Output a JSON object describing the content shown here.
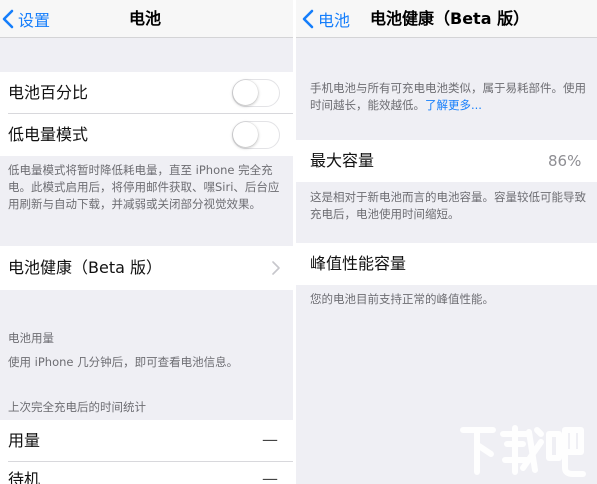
{
  "left": {
    "navbar": {
      "back_label": "设置",
      "title": "电池"
    },
    "battery_percentage": {
      "label": "电池百分比",
      "enabled": false
    },
    "low_power_mode": {
      "label": "低电量模式",
      "enabled": false
    },
    "low_power_footnote": "低电量模式将暂时降低耗电量，直至 iPhone 完全充电。此模式启用后，将停用邮件获取、嘿Siri、后台应用刷新与自动下载，并减弱或关闭部分视觉效果。",
    "battery_health_row": {
      "label": "电池健康（Beta 版）"
    },
    "battery_usage": {
      "header": "电池用量",
      "info": "使用 iPhone 几分钟后，即可查看电池信息。"
    },
    "stats": {
      "header": "上次完全充电后的时间统计",
      "rows": [
        {
          "label": "用量",
          "value": "—"
        },
        {
          "label": "待机",
          "value": "—"
        }
      ]
    }
  },
  "right": {
    "navbar": {
      "back_label": "电池",
      "title": "电池健康（Beta 版）"
    },
    "intro": {
      "text": "手机电池与所有可充电电池类似，属于易耗部件。使用时间越长，能效越低。",
      "link": "了解更多..."
    },
    "max_capacity": {
      "label": "最大容量",
      "value": "86%"
    },
    "max_capacity_footnote": "这是相对于新电池而言的电池容量。容量较低可能导致充电后，电池使用时间缩短。",
    "peak_performance": {
      "label": "峰值性能容量"
    },
    "peak_performance_footnote": "您的电池目前支持正常的峰值性能。"
  },
  "watermark": {
    "text": "下载吧"
  },
  "colors": {
    "accent": "#157efb",
    "background": "#efeff4",
    "secondary_text": "#6d6d72"
  },
  "icons": {
    "back": "chevron-left-icon",
    "disclosure": "chevron-right-icon"
  }
}
